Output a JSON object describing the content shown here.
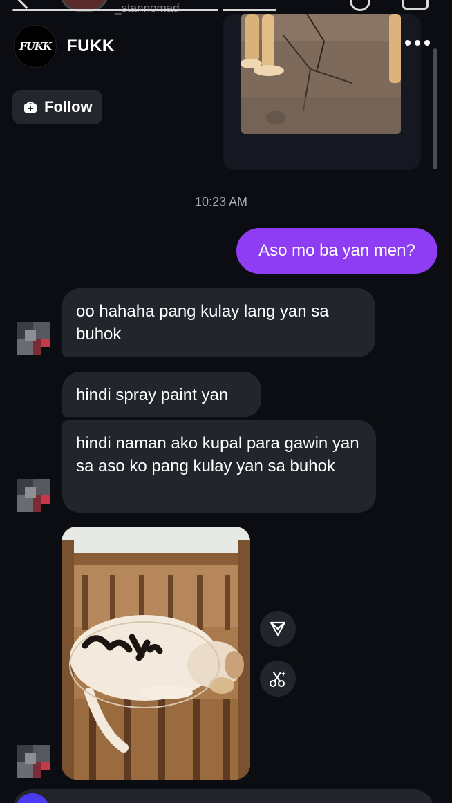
{
  "status_strip": {
    "username": "_stannomad"
  },
  "header": {
    "avatar_logo_text": "FUKK",
    "profile_name": "FUKK",
    "follow_label": "Follow"
  },
  "conversation": {
    "timestamp": "10:23 AM",
    "messages": [
      {
        "from": "me",
        "text": "Aso mo ba yan men?"
      },
      {
        "from": "them",
        "text": "oo hahaha pang kulay lang yan sa buhok"
      },
      {
        "from": "them",
        "text": "hindi spray paint yan"
      },
      {
        "from": "them",
        "text": "hindi naman ako kupal para gawin yan sa aso ko pang kulay yan sa buhok"
      }
    ]
  },
  "icons": {
    "more": "more-dots-icon",
    "follow": "add-friend-icon",
    "share": "share-send-icon",
    "edit": "scissors-sparkle-icon"
  },
  "colors": {
    "background": "#0b0d12",
    "outgoing_bubble": "#8f3df2",
    "incoming_bubble": "#22252c",
    "timestamp": "#a9abb2"
  }
}
